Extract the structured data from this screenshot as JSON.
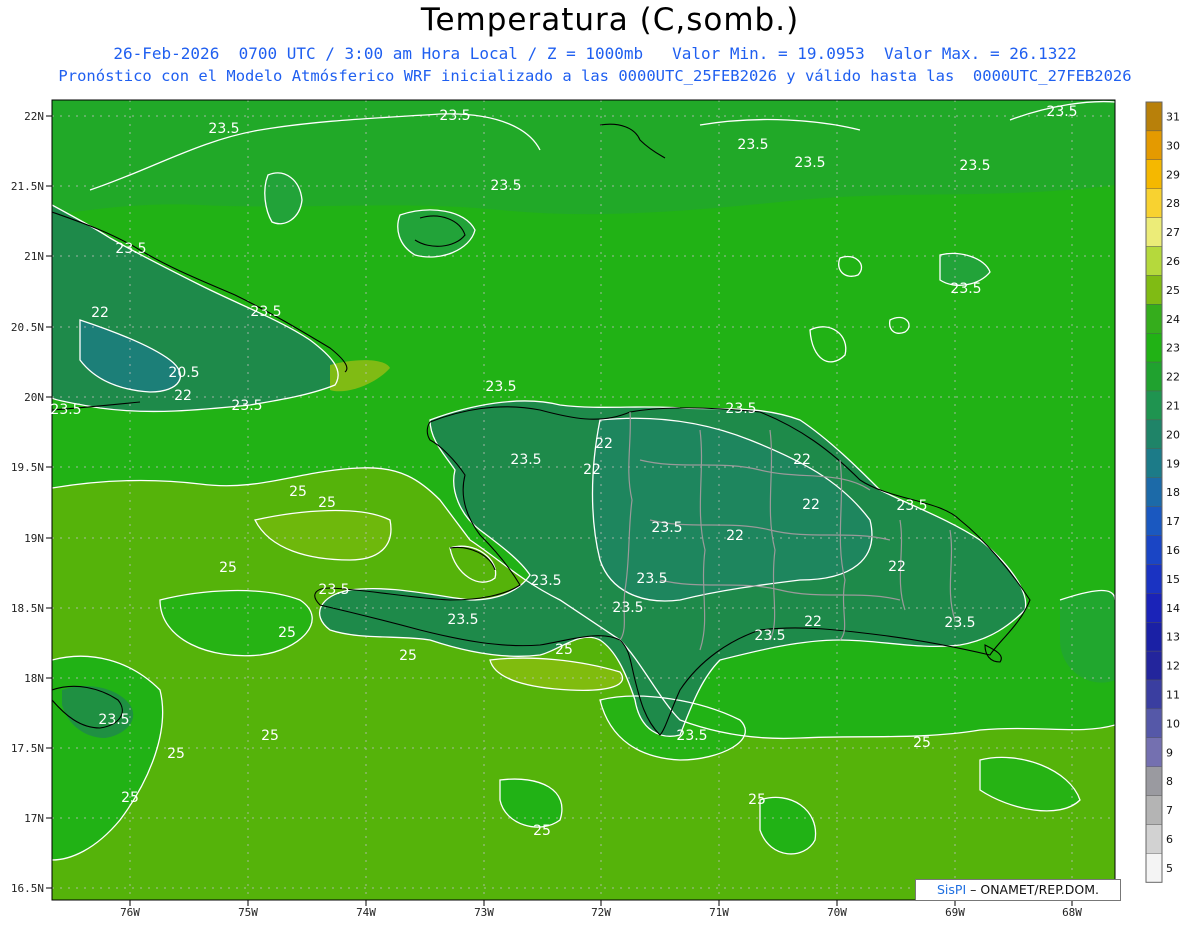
{
  "header": {
    "title": "Temperatura (C,somb.)",
    "line1": "26-Feb-2026  0700 UTC / 3:00 am Hora Local / Z = 1000mb   Valor Min. = 19.0953  Valor Max. = 26.1322",
    "line2": "Pronóstico con el Modelo Atmósferico WRF inicializado a las 0000UTC_25FEB2026 y válido hasta las  0000UTC_27FEB2026"
  },
  "map": {
    "lat_labels": [
      "22N",
      "21.5N",
      "21N",
      "20.5N",
      "20N",
      "19.5N",
      "19N",
      "18.5N",
      "18N",
      "17.5N",
      "17N",
      "16.5N"
    ],
    "lon_labels": [
      "76W",
      "75W",
      "74W",
      "73W",
      "72W",
      "71W",
      "70W",
      "69W",
      "68W"
    ],
    "contour_labels": [
      "23.5",
      "22",
      "20.5",
      "25"
    ],
    "colors": {
      "t22": "#1e8a4a",
      "t23": "#22a339",
      "t24": "#21b215",
      "t25": "#55b30a",
      "t26": "#8fbf10",
      "contour": "#ffffff",
      "coast": "#000000",
      "border": "#9a9a9a"
    }
  },
  "colorbar": {
    "labels": [
      "31",
      "30",
      "29",
      "28",
      "27",
      "26",
      "25",
      "24",
      "23",
      "22",
      "21",
      "20",
      "19",
      "18",
      "17",
      "16",
      "15",
      "14",
      "13",
      "12",
      "11",
      "10",
      "9",
      "8",
      "7",
      "6",
      "5"
    ],
    "colors": [
      "#b8800a",
      "#e49a00",
      "#f5b800",
      "#f8d230",
      "#ecec78",
      "#b5d93c",
      "#80bb14",
      "#35ad1c",
      "#21b215",
      "#20a22f",
      "#1f9450",
      "#1f8468",
      "#1c7b88",
      "#1c6aa8",
      "#1a58c0",
      "#1a45c5",
      "#1a33c2",
      "#1a23b8",
      "#1a20a5",
      "#23259c",
      "#3a3ea0",
      "#5558a8",
      "#7470b0",
      "#9a9aa0",
      "#b4b4b4",
      "#d2d2d2",
      "#f4f4f4"
    ]
  },
  "credit": {
    "brand": "SisPI",
    "text": " – ONAMET/REP.DOM."
  }
}
